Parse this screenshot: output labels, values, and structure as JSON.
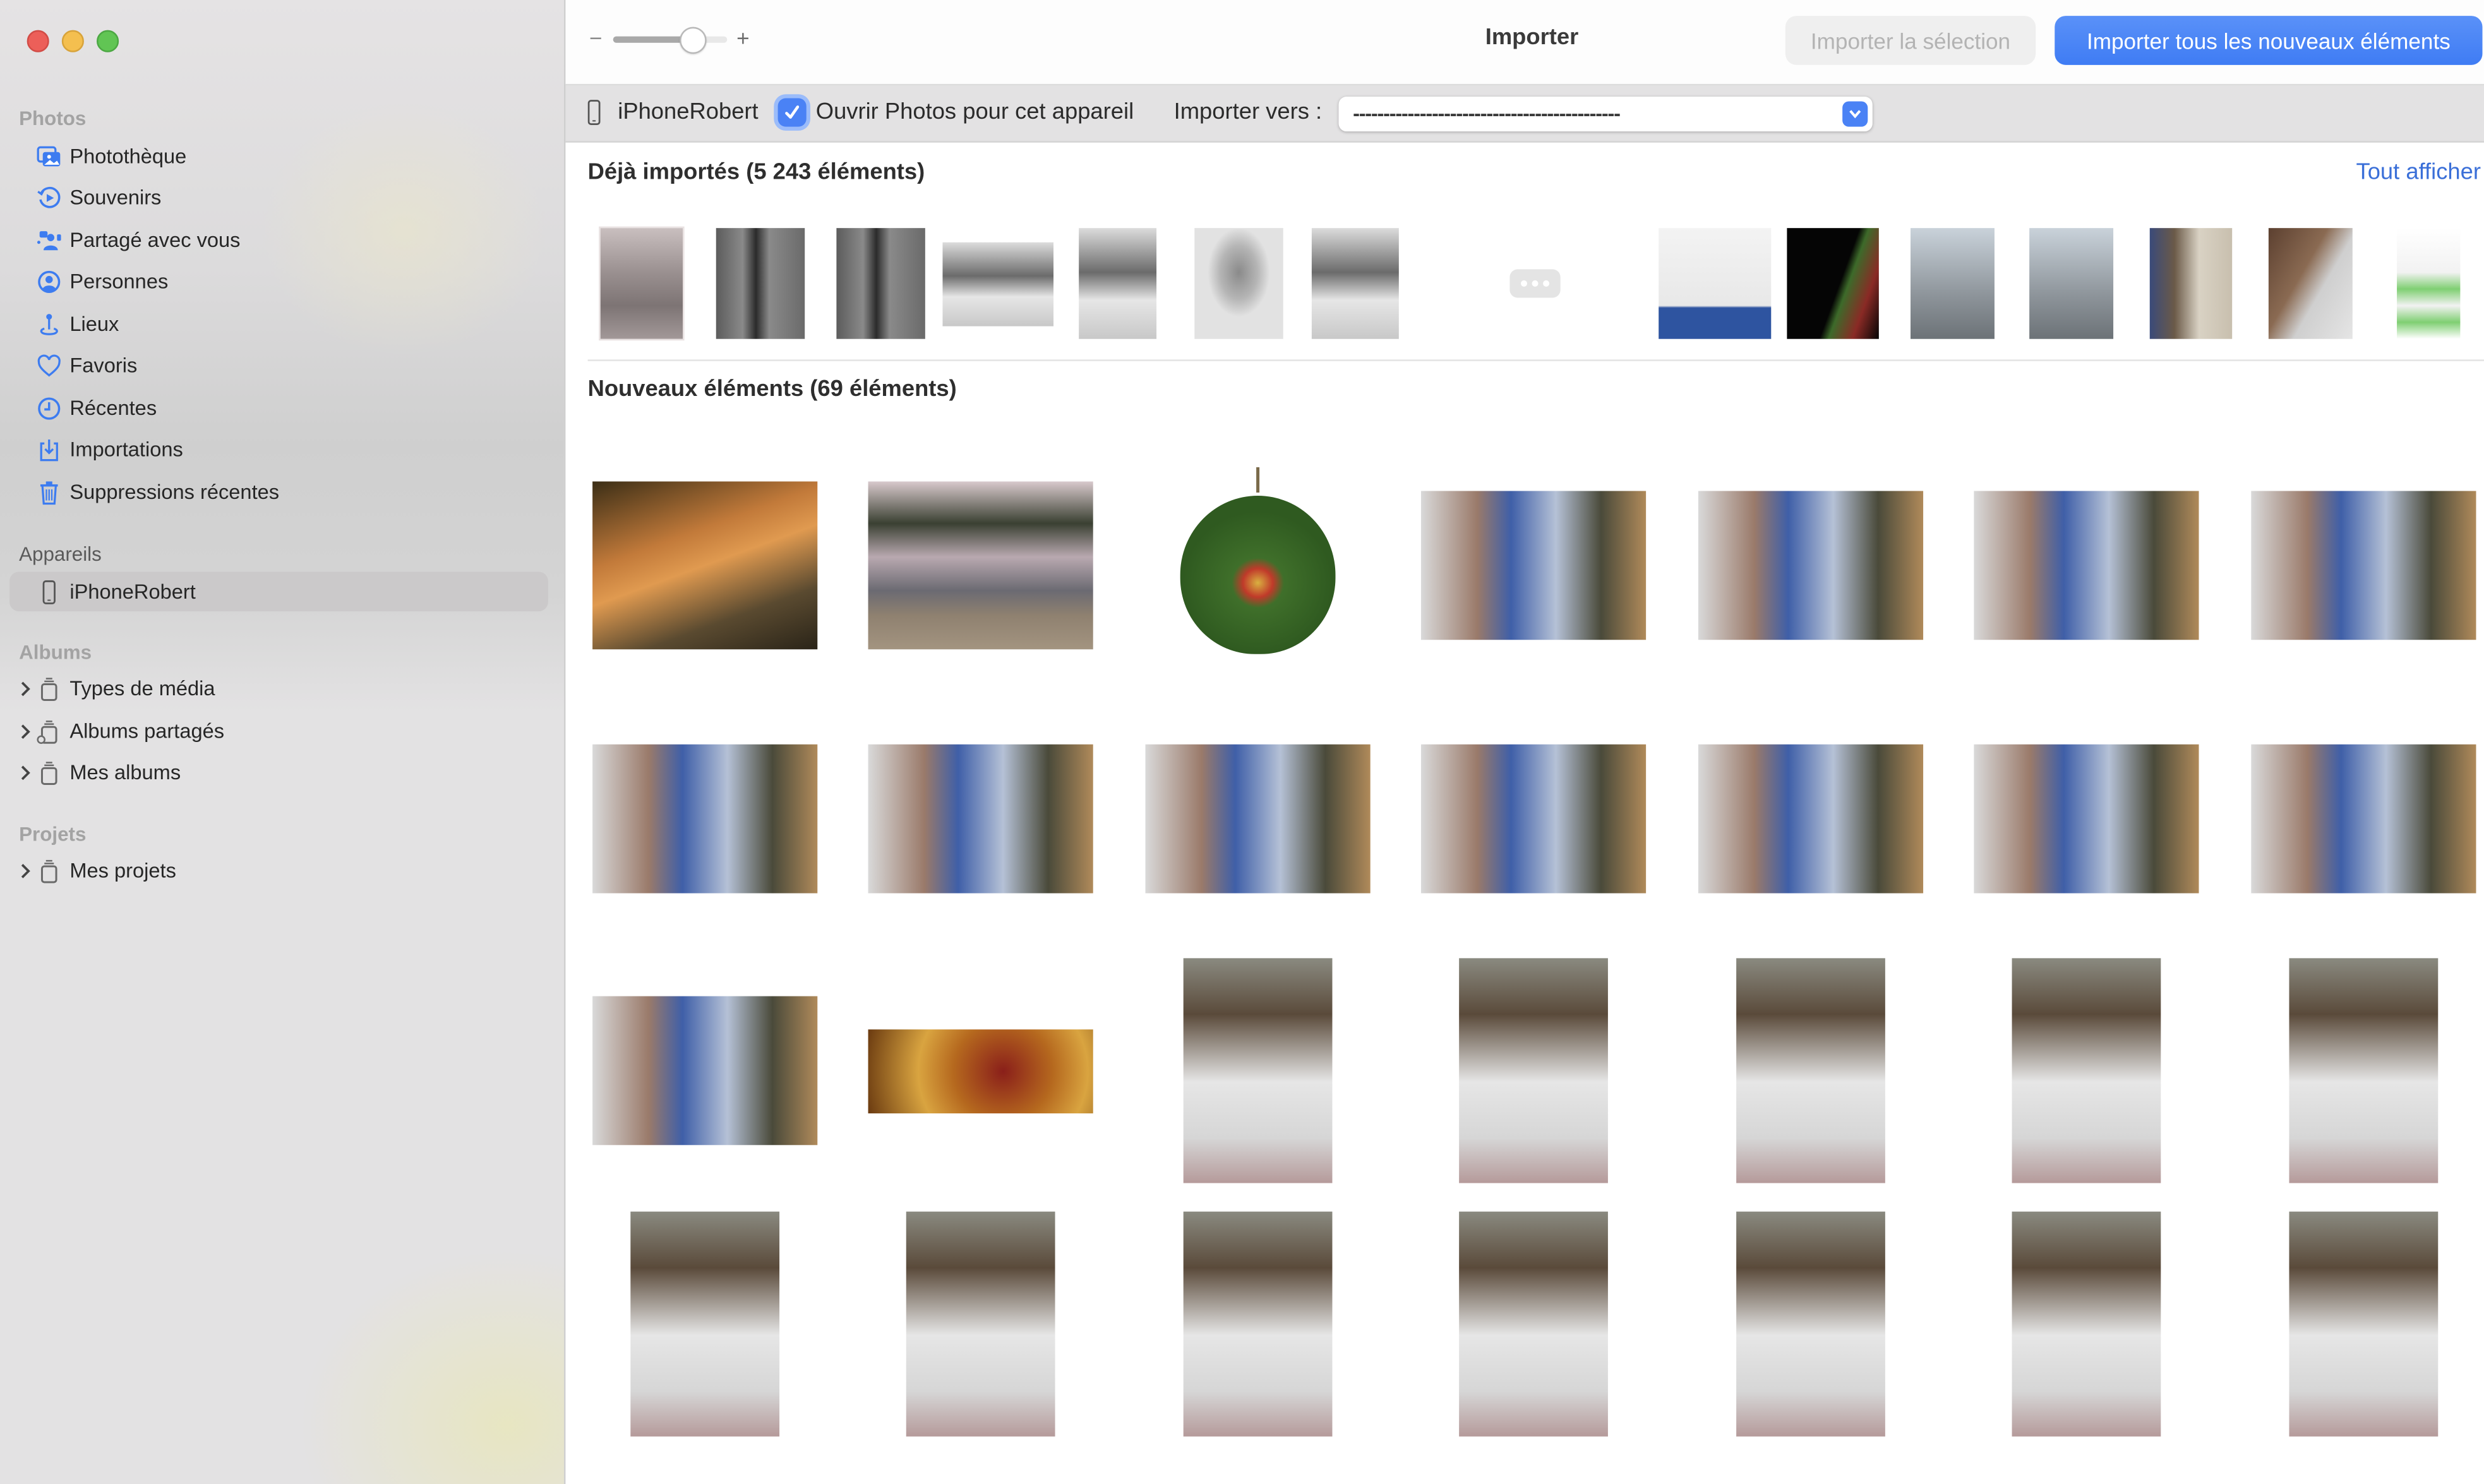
{
  "window": {
    "title": "Importer",
    "traffic_lights": [
      "close",
      "minimize",
      "zoom"
    ]
  },
  "sidebar": {
    "sections": [
      {
        "title": "Photos",
        "items": [
          {
            "label": "Photothèque",
            "icon": "photo-library-icon"
          },
          {
            "label": "Souvenirs",
            "icon": "memories-icon"
          },
          {
            "label": "Partagé avec vous",
            "icon": "shared-with-you-icon"
          },
          {
            "label": "Personnes",
            "icon": "people-icon"
          },
          {
            "label": "Lieux",
            "icon": "places-pin-icon"
          },
          {
            "label": "Favoris",
            "icon": "heart-icon"
          },
          {
            "label": "Récentes",
            "icon": "clock-icon"
          },
          {
            "label": "Importations",
            "icon": "import-tray-icon"
          },
          {
            "label": "Suppressions récentes",
            "icon": "trash-icon"
          }
        ]
      },
      {
        "title": "Appareils",
        "items": [
          {
            "label": "iPhoneRobert",
            "icon": "iphone-icon",
            "selected": true
          }
        ]
      },
      {
        "title": "Albums",
        "items": [
          {
            "label": "Types de média",
            "icon": "album-stack-icon",
            "expandable": true
          },
          {
            "label": "Albums partagés",
            "icon": "shared-album-stack-icon",
            "expandable": true
          },
          {
            "label": "Mes albums",
            "icon": "album-stack-icon",
            "expandable": true
          }
        ]
      },
      {
        "title": "Projets",
        "items": [
          {
            "label": "Mes projets",
            "icon": "album-stack-icon",
            "expandable": true
          }
        ]
      }
    ]
  },
  "toolbar": {
    "zoom_minus": "−",
    "zoom_plus": "+",
    "zoom_level_fraction": 0.7,
    "import_selection_label": "Importer la sélection",
    "import_selection_enabled": false,
    "import_all_label": "Importer tous les nouveaux éléments"
  },
  "device_bar": {
    "device_name": "iPhoneRobert",
    "open_photos_label": "Ouvrir Photos pour cet appareil",
    "open_photos_checked": true,
    "import_to_label": "Importer vers :",
    "import_to_value": "--------------------------------------------"
  },
  "already_imported": {
    "title": "Déjà importés (5 243 éléments)",
    "show_all_label": "Tout afficher",
    "thumbnails": [
      {
        "subject": "old-photo-children-bicycle",
        "tone": "sepia"
      },
      {
        "subject": "shed-door-people-bw",
        "tone": "bw"
      },
      {
        "subject": "shed-door-people-bw",
        "tone": "bw"
      },
      {
        "subject": "two-men-architectural-model-bw",
        "tone": "bw"
      },
      {
        "subject": "two-men-architectural-model-bw",
        "tone": "bw"
      },
      {
        "subject": "portrait-smiling-man-bw",
        "tone": "bw"
      },
      {
        "subject": "two-men-architectural-model-bw",
        "tone": "bw"
      },
      {
        "subject": "more-indicator",
        "tone": "placeholder"
      },
      {
        "subject": "shower-base-advert-en-ligne",
        "tone": "color"
      },
      {
        "subject": "dark-green-red-light",
        "tone": "color"
      },
      {
        "subject": "bare-tree-through-window",
        "tone": "color"
      },
      {
        "subject": "bare-tree-through-window",
        "tone": "color"
      },
      {
        "subject": "kitchen-door-frame",
        "tone": "color"
      },
      {
        "subject": "wood-frame-corner",
        "tone": "color"
      },
      {
        "subject": "messages-screenshot",
        "tone": "color"
      }
    ]
  },
  "new_items": {
    "title": "Nouveaux éléments (69 éléments)",
    "photos": [
      {
        "subject": "campfire-group-lake"
      },
      {
        "subject": "lake-canoe-dusk"
      },
      {
        "subject": "christmas-ornament-stocking"
      },
      {
        "subject": "family-newborn-blue-curtain"
      },
      {
        "subject": "family-newborn-blue-curtain"
      },
      {
        "subject": "family-newborn-blue-curtain"
      },
      {
        "subject": "family-newborn-blue-curtain"
      },
      {
        "subject": "family-newborn-blue-curtain"
      },
      {
        "subject": "family-newborn-blue-curtain"
      },
      {
        "subject": "family-newborn-blue-curtain"
      },
      {
        "subject": "family-newborn-blue-curtain"
      },
      {
        "subject": "family-newborn-blue-curtain"
      },
      {
        "subject": "family-newborn-blue-curtain"
      },
      {
        "subject": "family-newborn-blue-curtain"
      },
      {
        "subject": "family-newborn-blue-curtain"
      },
      {
        "subject": "christmas-baubles-gold"
      },
      {
        "subject": "father-holding-newborn"
      },
      {
        "subject": "father-holding-newborn"
      },
      {
        "subject": "father-holding-newborn"
      },
      {
        "subject": "father-holding-newborn"
      },
      {
        "subject": "father-holding-newborn"
      },
      {
        "subject": "father-holding-newborn"
      },
      {
        "subject": "father-holding-newborn"
      },
      {
        "subject": "father-holding-newborn"
      },
      {
        "subject": "father-holding-newborn"
      },
      {
        "subject": "father-holding-newborn"
      },
      {
        "subject": "father-holding-newborn"
      },
      {
        "subject": "father-holding-newborn"
      }
    ]
  },
  "colors": {
    "accent": "#3f7cf4",
    "link": "#3a6fd8",
    "sidebar_icon": "#3d7cf0",
    "sidebar_selected": "#cbc9ca",
    "close": "#ec5f59",
    "minimize": "#f4bf4f",
    "zoom": "#61c554"
  }
}
